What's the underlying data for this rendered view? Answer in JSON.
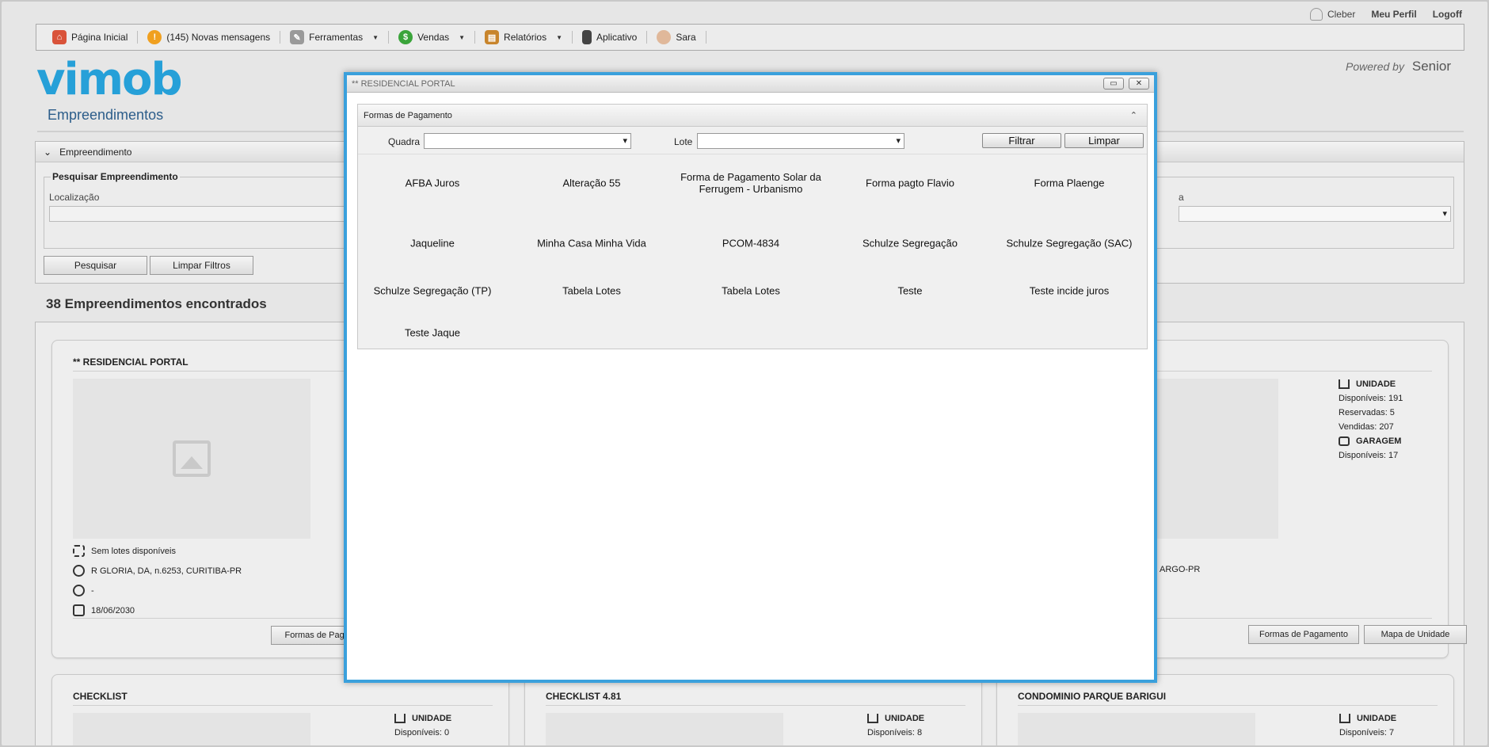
{
  "top_links": {
    "user": "Cleber",
    "profile": "Meu Perfil",
    "logoff": "Logoff"
  },
  "menu": [
    {
      "label": "Página Inicial",
      "icon": "home-icon"
    },
    {
      "label": "(145) Novas mensagens",
      "icon": "alert-icon"
    },
    {
      "label": "Ferramentas",
      "icon": "tools-icon",
      "dropdown": true
    },
    {
      "label": "Vendas",
      "icon": "dollar-icon",
      "dropdown": true
    },
    {
      "label": "Relatórios",
      "icon": "report-icon",
      "dropdown": true
    },
    {
      "label": "Aplicativo",
      "icon": "phone-icon"
    },
    {
      "label": "Sara",
      "icon": "avatar-icon"
    }
  ],
  "brand": {
    "logo": "vimob",
    "powered_by": "Powered by",
    "partner": "Senior"
  },
  "page_title": "Empreendimentos",
  "filter_panel": {
    "header": "Empreendimento",
    "legend": "Pesquisar Empreendimento",
    "location_label": "Localização",
    "right_label": "a",
    "search_button": "Pesquisar",
    "clear_button": "Limpar Filtros"
  },
  "results_count": "38 Empreendimentos encontrados",
  "cards": {
    "first": {
      "title": "** RESIDENCIAL PORTAL",
      "lots": "Sem lotes disponíveis",
      "address": "R GLORIA, DA, n.6253, CURITIBA-PR",
      "price": "-",
      "date": "18/06/2030",
      "button": "Formas de Pagar"
    },
    "right": {
      "address_fragment": "ARGO-PR",
      "unit_heading": "UNIDADE",
      "available": "Disponíveis: 191",
      "reserved": "Reservadas: 5",
      "sold": "Vendidas: 207",
      "garage_heading": "GARAGEM",
      "garage_available": "Disponíveis: 17",
      "payment_button": "Formas de Pagamento",
      "map_button": "Mapa de Unidade"
    },
    "checklist": {
      "title": "CHECKLIST",
      "unit_heading": "UNIDADE",
      "available": "Disponíveis: 0"
    },
    "checklist481": {
      "title": "CHECKLIST 4.81",
      "unit_heading": "UNIDADE",
      "available": "Disponíveis: 8"
    },
    "barigui": {
      "title": "CONDOMINIO PARQUE BARIGUI",
      "unit_heading": "UNIDADE",
      "available": "Disponíveis: 7"
    }
  },
  "modal": {
    "title": "** RESIDENCIAL PORTAL",
    "section": "Formas de Pagamento",
    "quadra_label": "Quadra",
    "quadra_value": "",
    "lote_label": "Lote",
    "lote_value": "",
    "filter_button": "Filtrar",
    "clear_button": "Limpar",
    "options": [
      "AFBA Juros",
      "Alteração 55",
      "Forma de Pagamento Solar da Ferrugem - Urbanismo",
      "Forma pagto Flavio",
      "Forma Plaenge",
      "Jaqueline",
      "Minha Casa Minha Vida",
      "PCOM-4834",
      "Schulze Segregação",
      "Schulze Segregação (SAC)",
      "Schulze Segregação (TP)",
      "Tabela Lotes",
      "Tabela Lotes",
      "Teste",
      "Teste incide juros",
      "Teste Jaque"
    ]
  },
  "colors": {
    "accent": "#3aa0dc",
    "logo": "#26a0d8",
    "title": "#2c5d8a"
  }
}
